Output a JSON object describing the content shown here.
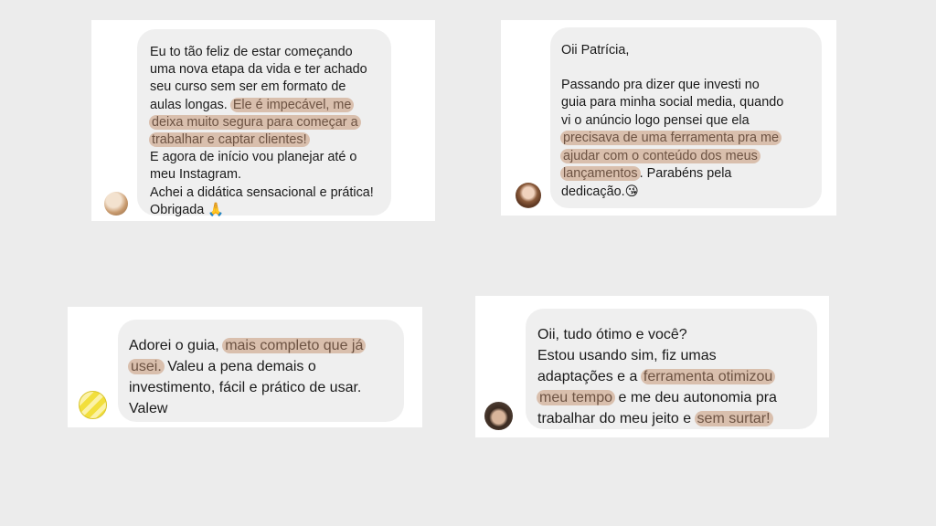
{
  "testimonials": [
    {
      "lines": [
        {
          "segments": [
            {
              "text": "Eu to tão feliz de estar começando",
              "hl": false
            }
          ]
        },
        {
          "segments": [
            {
              "text": "uma nova etapa da vida e ter achado",
              "hl": false
            }
          ]
        },
        {
          "segments": [
            {
              "text": "seu curso sem ser em formato de",
              "hl": false
            }
          ]
        },
        {
          "segments": [
            {
              "text": "aulas longas. ",
              "hl": false
            },
            {
              "text": "Ele é impecável, me",
              "hl": true
            }
          ]
        },
        {
          "segments": [
            {
              "text": "deixa muito segura para começar a",
              "hl": true
            }
          ]
        },
        {
          "segments": [
            {
              "text": "trabalhar e captar clientes!",
              "hl": true
            }
          ]
        },
        {
          "segments": [
            {
              "text": "E agora de início vou planejar até o",
              "hl": false
            }
          ]
        },
        {
          "segments": [
            {
              "text": "meu Instagram.",
              "hl": false
            }
          ]
        },
        {
          "segments": [
            {
              "text": "Achei a didática sensacional e prática!",
              "hl": false
            }
          ]
        },
        {
          "segments": [
            {
              "text": "Obrigada 🙏",
              "hl": false
            }
          ]
        }
      ]
    },
    {
      "lines": [
        {
          "segments": [
            {
              "text": "Oii Patrícia,",
              "hl": false
            }
          ]
        },
        {
          "gap": true
        },
        {
          "segments": [
            {
              "text": "Passando pra dizer que investi no",
              "hl": false
            }
          ]
        },
        {
          "segments": [
            {
              "text": "guia para minha social media, quando",
              "hl": false
            }
          ]
        },
        {
          "segments": [
            {
              "text": "vi o anúncio logo pensei que ela",
              "hl": false
            }
          ]
        },
        {
          "segments": [
            {
              "text": "precisava de uma ferramenta pra me",
              "hl": true
            }
          ]
        },
        {
          "segments": [
            {
              "text": "ajudar com o conteúdo dos meus",
              "hl": true
            }
          ]
        },
        {
          "segments": [
            {
              "text": "lançamentos",
              "hl": true
            },
            {
              "text": ". Parabéns pela",
              "hl": false
            }
          ]
        },
        {
          "segments": [
            {
              "text": "dedicação.😘",
              "hl": false
            }
          ]
        }
      ]
    },
    {
      "lines": [
        {
          "segments": [
            {
              "text": "Adorei o guia, ",
              "hl": false
            },
            {
              "text": "mais completo que já",
              "hl": true
            }
          ]
        },
        {
          "segments": [
            {
              "text": "usei.",
              "hl": true
            },
            {
              "text": " Valeu a pena demais o",
              "hl": false
            }
          ]
        },
        {
          "segments": [
            {
              "text": "investimento, fácil e prático de usar.",
              "hl": false
            }
          ]
        },
        {
          "segments": [
            {
              "text": "Valew",
              "hl": false
            }
          ]
        }
      ]
    },
    {
      "lines": [
        {
          "segments": [
            {
              "text": "Oii, tudo ótimo e você?",
              "hl": false
            }
          ]
        },
        {
          "segments": [
            {
              "text": "Estou usando sim, fiz umas",
              "hl": false
            }
          ]
        },
        {
          "segments": [
            {
              "text": "adaptações e a ",
              "hl": false
            },
            {
              "text": "ferramenta otimizou",
              "hl": true
            }
          ]
        },
        {
          "segments": [
            {
              "text": "meu tempo",
              "hl": true
            },
            {
              "text": " e me deu autonomia pra",
              "hl": false
            }
          ]
        },
        {
          "segments": [
            {
              "text": "trabalhar do meu jeito e ",
              "hl": false
            },
            {
              "text": "sem surtar!",
              "hl": true
            }
          ]
        }
      ]
    }
  ],
  "colors": {
    "background": "#ececec",
    "card": "#ffffff",
    "bubble": "#efefef",
    "highlight": "#d9bfad",
    "highlight_text": "#6d5343"
  }
}
